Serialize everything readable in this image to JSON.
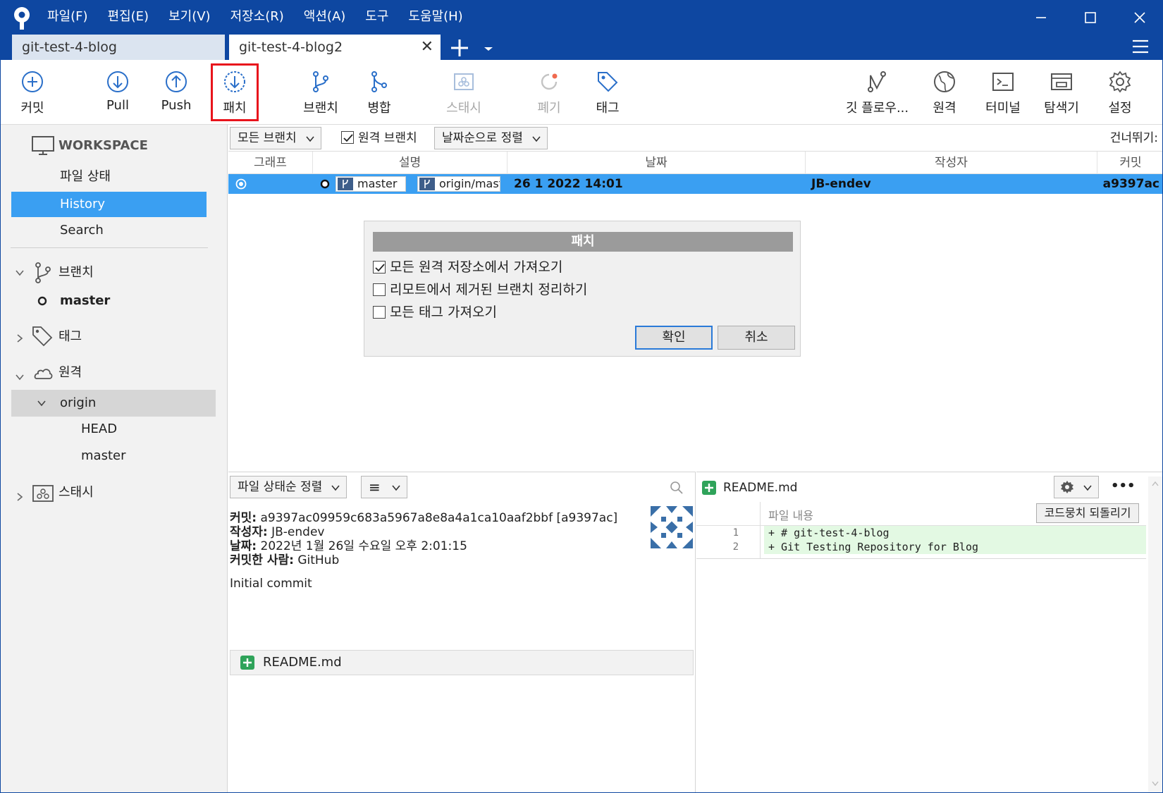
{
  "menu": [
    "파일(F)",
    "편집(E)",
    "보기(V)",
    "저장소(R)",
    "액션(A)",
    "도구",
    "도움말(H)"
  ],
  "tabs": [
    {
      "label": "git-test-4-blog"
    },
    {
      "label": "git-test-4-blog2",
      "close": "✕"
    }
  ],
  "toolbar": {
    "commit": "커밋",
    "pull": "Pull",
    "push": "Push",
    "fetch": "패치",
    "branch": "브랜치",
    "merge": "병합",
    "stash": "스태시",
    "discard": "폐기",
    "tag": "태그",
    "gitflow": "깃 플로우...",
    "remote": "원격",
    "terminal": "터미널",
    "explorer": "탐색기",
    "settings": "설정"
  },
  "sidebar": {
    "workspace": "WORKSPACE",
    "file_status": "파일 상태",
    "history": "History",
    "search": "Search",
    "branches": "브랜치",
    "branch_master": "master",
    "tags": "태그",
    "remotes": "원격",
    "origin": "origin",
    "origin_head": "HEAD",
    "origin_master": "master",
    "stash": "스태시"
  },
  "filter": {
    "branches": "모든 브랜치",
    "remote_branches": "원격 브랜치",
    "sort": "날짜순으로 정렬",
    "jump": "건너뛰기:"
  },
  "table": {
    "columns": [
      "그래프",
      "설명",
      "날짜",
      "작성자",
      "커밋"
    ],
    "row": {
      "ref_local": "master",
      "ref_remote": "origin/mast",
      "date": "26 1 2022 14:01",
      "author": "JB-endev",
      "commit": "a9397ac"
    }
  },
  "dialog": {
    "title": "패치",
    "options": [
      {
        "label": "모든 원격 저장소에서 가져오기",
        "checked": true
      },
      {
        "label": "리모트에서 제거된 브랜치 정리하기",
        "checked": false
      },
      {
        "label": "모든 태그 가져오기",
        "checked": false
      }
    ],
    "ok": "확인",
    "cancel": "취소"
  },
  "lower": {
    "sort": "파일 상태순 정렬",
    "list_icon": "≡",
    "commit_label": "커밋:",
    "commit_value": "a9397ac09959c683a5967a8e8a4a1ca10aaf2bbf [a9397ac]",
    "author_label": "작성자:",
    "author_value": "JB-endev",
    "date_label": "날짜:",
    "date_value": "2022년 1월 26일 수요일 오후 2:01:15",
    "committer_label": "커밋한 사람:",
    "committer_value": "GitHub",
    "message": "Initial commit",
    "file": "README.md"
  },
  "diff": {
    "file": "README.md",
    "section": "파일 내용",
    "revert": "코드뭉치 되돌리기",
    "more": "•••",
    "lines": [
      {
        "num": "1",
        "text": "+ # git-test-4-blog"
      },
      {
        "num": "2",
        "text": "+ Git Testing Repository for Blog"
      }
    ]
  },
  "colors": {
    "titlebar": "#0e47a1",
    "accent": "#3a9ff2",
    "highlight": "#e8141c",
    "diff_add": "#e3f9e3"
  }
}
